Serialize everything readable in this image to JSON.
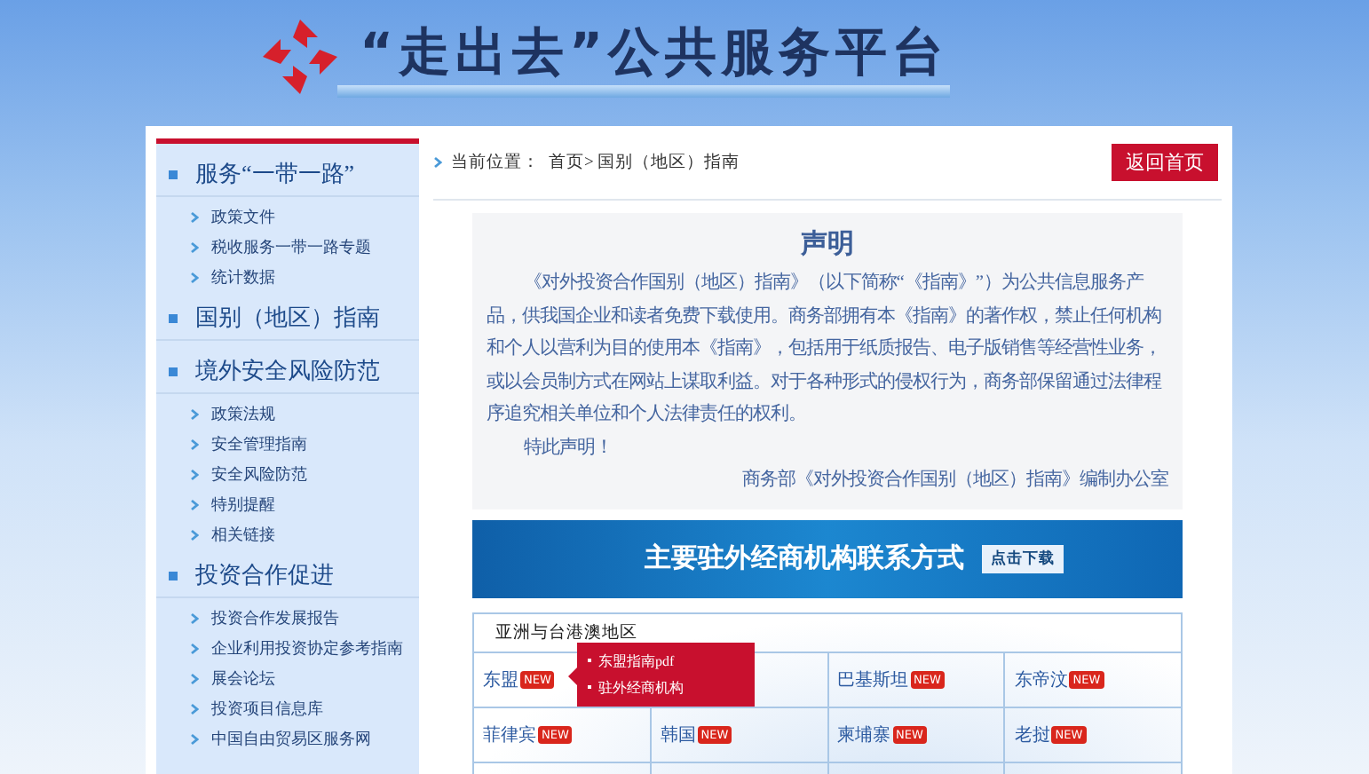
{
  "header": {
    "title": "“走出去”公共服务平台"
  },
  "sidebar": {
    "sections": [
      {
        "title": "服务“一带一路”",
        "items": [
          "政策文件",
          "税收服务一带一路专题",
          "统计数据"
        ]
      },
      {
        "title": "国别（地区）指南"
      },
      {
        "title": "境外安全风险防范",
        "items": [
          "政策法规",
          "安全管理指南",
          "安全风险防范",
          "特别提醒",
          "相关链接"
        ]
      },
      {
        "title": "投资合作促进",
        "items": [
          "投资合作发展报告",
          "企业利用投资协定参考指南",
          "展会论坛",
          "投资项目信息库",
          "中国自由贸易区服务网"
        ]
      }
    ]
  },
  "breadcrumb": {
    "label": "当前位置：",
    "path": "首页> 国别（地区）指南"
  },
  "home_button": "返回首页",
  "notice": {
    "title": "声明",
    "paragraphs": [
      "《对外投资合作国别（地区）指南》（以下简称“《指南》”）为公共信息服务产品，供我国企业和读者免费下载使用。商务部拥有本《指南》的著作权，禁止任何机构和个人以营利为目的使用本《指南》，包括用于纸质报告、电子版销售等经营性业务，或以会员制方式在网站上谋取利益。对于各种形式的侵权行为，商务部保留通过法律程序追究相关单位和个人法律责任的权利。",
      "特此声明！"
    ],
    "signature": "商务部《对外投资合作国别（地区）指南》编制办公室"
  },
  "banner": {
    "title": "主要驻外经商机构联系方式",
    "button": "点击下载"
  },
  "region_table": {
    "title": "亚洲与台港澳地区",
    "rows": [
      [
        {
          "name": "东盟",
          "badge": "NEW"
        },
        {},
        {
          "name": "巴基斯坦",
          "badge": "NEW"
        },
        {
          "name": "东帝汶",
          "badge": "NEW"
        }
      ],
      [
        {
          "name": "菲律宾",
          "badge": "NEW"
        },
        {
          "name": "韩国",
          "badge": "NEW"
        },
        {
          "name": "柬埔寨",
          "badge": "NEW"
        },
        {
          "name": "老挝",
          "badge": "NEW"
        }
      ]
    ]
  },
  "popup": {
    "items": [
      "东盟指南pdf",
      "驻外经商机构"
    ]
  }
}
